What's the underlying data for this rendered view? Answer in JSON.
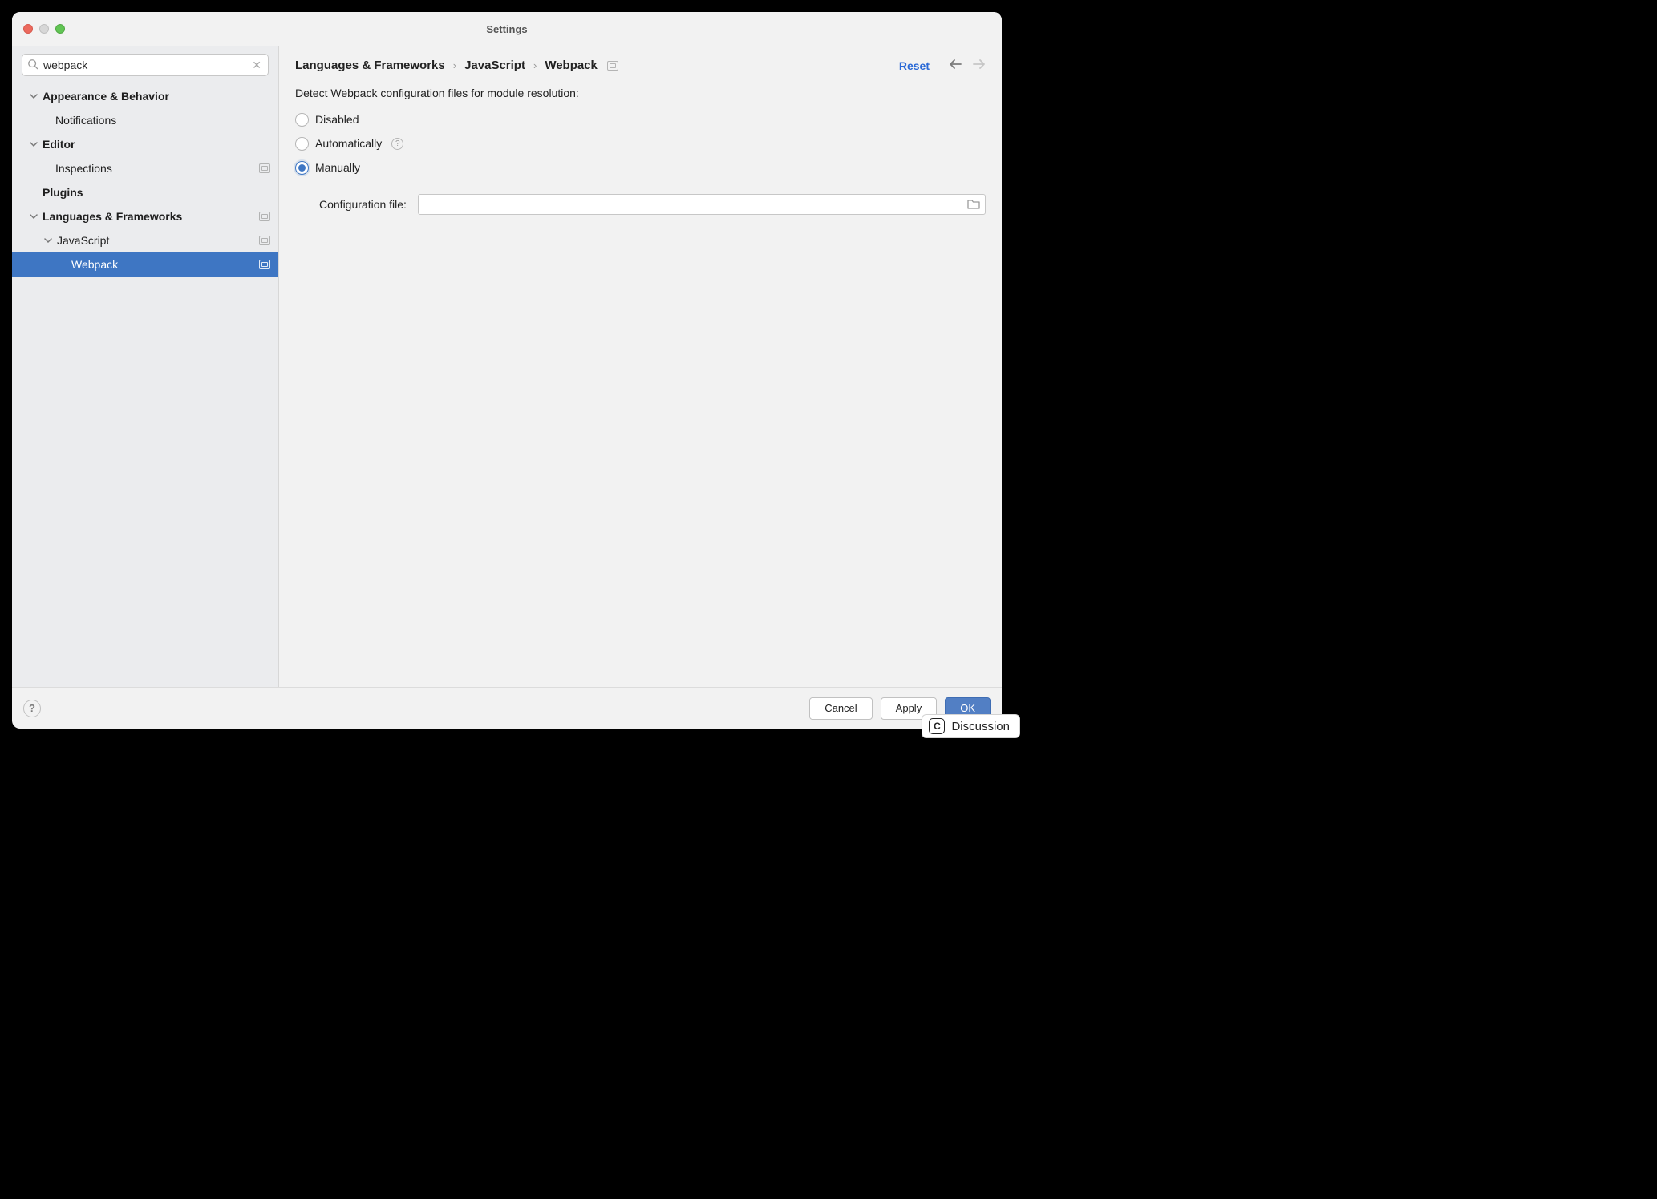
{
  "window": {
    "title": "Settings"
  },
  "search": {
    "value": "webpack"
  },
  "sidebar": {
    "items": [
      {
        "label": "Appearance & Behavior",
        "level": 0,
        "bold": true,
        "arrow": true,
        "badge": false,
        "selected": false
      },
      {
        "label": "Notifications",
        "level": 1,
        "bold": false,
        "arrow": false,
        "badge": false,
        "selected": false
      },
      {
        "label": "Editor",
        "level": 0,
        "bold": true,
        "arrow": true,
        "badge": false,
        "selected": false
      },
      {
        "label": "Inspections",
        "level": 1,
        "bold": false,
        "arrow": false,
        "badge": true,
        "selected": false
      },
      {
        "label": "Plugins",
        "level": 0,
        "bold": true,
        "arrow": false,
        "badge": false,
        "selected": false
      },
      {
        "label": "Languages & Frameworks",
        "level": 0,
        "bold": true,
        "arrow": true,
        "badge": true,
        "selected": false
      },
      {
        "label": "JavaScript",
        "level": 1,
        "bold": false,
        "arrow": true,
        "badge": true,
        "selected": false
      },
      {
        "label": "Webpack",
        "level": 2,
        "bold": false,
        "arrow": false,
        "badge": true,
        "selected": true
      }
    ]
  },
  "breadcrumb": {
    "items": [
      "Languages & Frameworks",
      "JavaScript",
      "Webpack"
    ]
  },
  "header": {
    "reset": "Reset"
  },
  "panel": {
    "detectLabel": "Detect Webpack configuration files for module resolution:",
    "options": {
      "disabled": "Disabled",
      "automatically": "Automatically",
      "manually": "Manually"
    },
    "configFileLabel": "Configuration file:",
    "configFileValue": ""
  },
  "footer": {
    "cancel": "Cancel",
    "apply_pre": "A",
    "apply_rest": "pply",
    "ok": "OK"
  },
  "overlay": {
    "discussion": "Discussion",
    "discussion_icon_letter": "C"
  }
}
